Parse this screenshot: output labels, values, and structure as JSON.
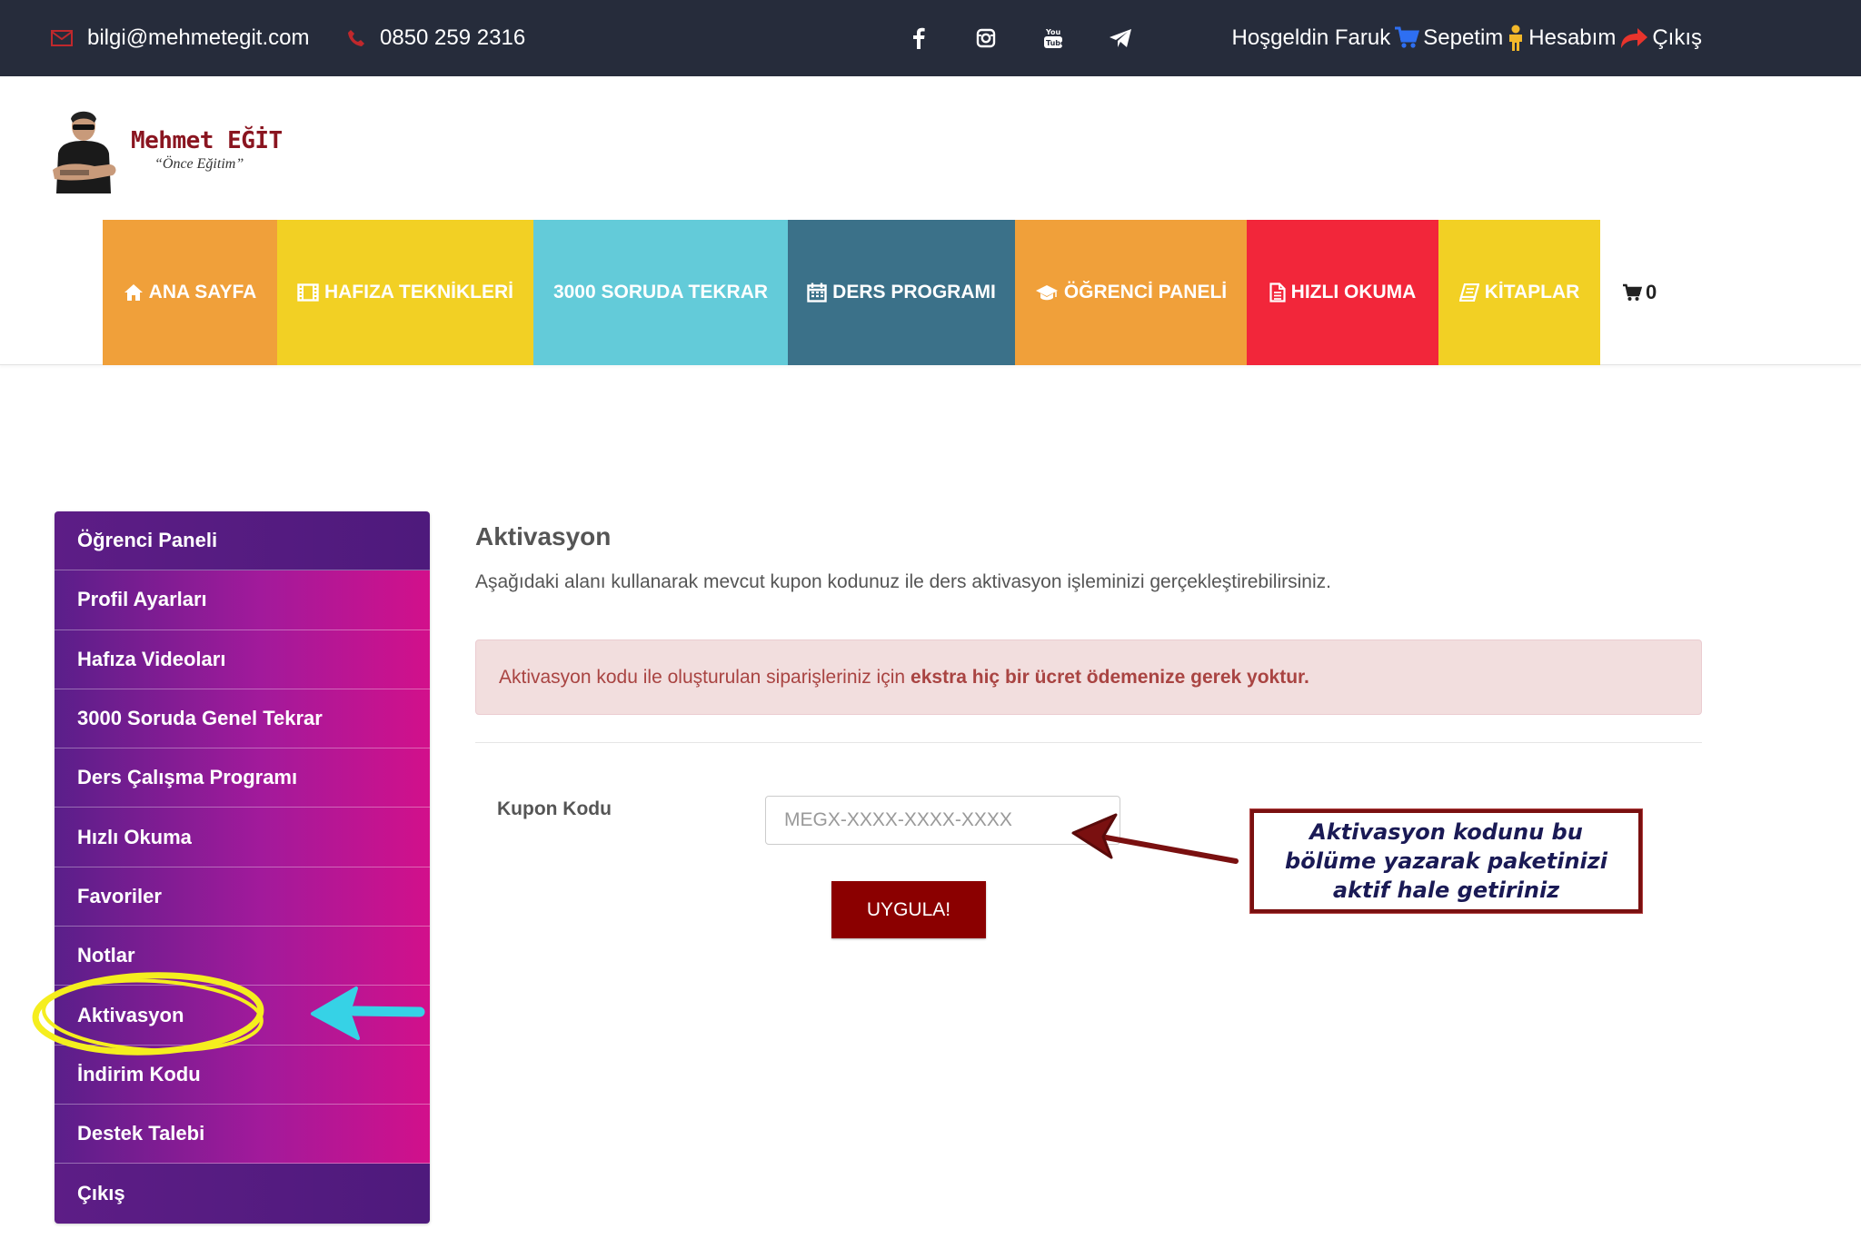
{
  "topbar": {
    "email": "bilgi@mehmetegit.com",
    "phone": "0850 259 2316",
    "social": [
      "facebook-icon",
      "instagram-icon",
      "youtube-icon",
      "telegram-icon"
    ],
    "welcome": "Hoşgeldin Faruk",
    "cart": "Sepetim",
    "account": "Hesabım",
    "logout": "Çıkış"
  },
  "logo": {
    "name": "Mehmet EĞİT",
    "tagline": "“Önce Eğitim”"
  },
  "nav": {
    "items": [
      {
        "label": "ANA SAYFA",
        "icon": "home-icon",
        "color": "#f0a03a"
      },
      {
        "label": "HAFIZA TEKNİKLERİ",
        "icon": "film-icon",
        "color": "#f2d024"
      },
      {
        "label": "3000 SORUDA TEKRAR",
        "icon": "",
        "color": "#63cbd9"
      },
      {
        "label": "DERS PROGRAMI",
        "icon": "calendar-icon",
        "color": "#3b7189"
      },
      {
        "label": "ÖĞRENCİ PANELİ",
        "icon": "graduation-cap-icon",
        "color": "#f0a03a"
      },
      {
        "label": "HIZLI OKUMA",
        "icon": "file-icon",
        "color": "#f2263a"
      },
      {
        "label": "KİTAPLAR",
        "icon": "book-icon",
        "color": "#f2d024"
      }
    ],
    "cart_count": "0"
  },
  "sidebar": {
    "items": [
      "Öğrenci Paneli",
      "Profil Ayarları",
      "Hafıza Videoları",
      "3000 Soruda Genel Tekrar",
      "Ders Çalışma Programı",
      "Hızlı Okuma",
      "Favoriler",
      "Notlar",
      "Aktivasyon",
      "İndirim Kodu",
      "Destek Talebi",
      "Çıkış"
    ]
  },
  "main": {
    "title": "Aktivasyon",
    "description": "Aşağıdaki alanı kullanarak mevcut kupon kodunuz ile ders aktivasyon işleminizi gerçekleştirebilirsiniz.",
    "alert_text": "Aktivasyon kodu ile oluşturulan siparişleriniz için",
    "alert_bold": "ekstra hiç bir ücret ödemenize gerek yoktur.",
    "coupon_label": "Kupon Kodu",
    "coupon_placeholder": "MEGX-XXXX-XXXX-XXXX",
    "coupon_value": "",
    "apply_label": "UYGULA!"
  },
  "annotation": {
    "note": "Aktivasyon kodunu bu bölüme yazarak paketinizi aktif hale getiriniz"
  },
  "colors": {
    "topbar": "#262c3b",
    "apply_button": "#8b0000",
    "alert_bg": "#f2dede",
    "alert_text": "#a94442",
    "highlight_ellipse": "#f5ee1e",
    "highlight_arrow": "#36d2e6",
    "annotation_arrow": "#7a1010"
  }
}
